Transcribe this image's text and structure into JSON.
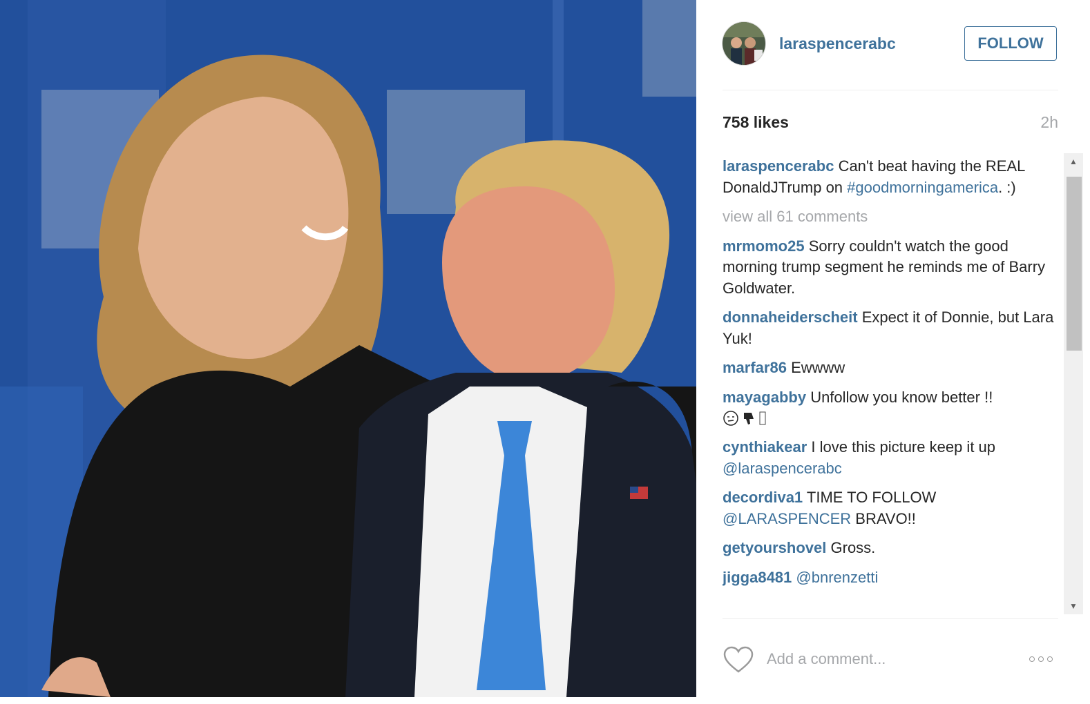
{
  "post": {
    "username": "laraspencerabc",
    "follow_label": "FOLLOW",
    "likes": "758 likes",
    "time": "2h",
    "caption": {
      "username": "laraspencerabc",
      "text": "Can't beat having the REAL DonaldJTrump on",
      "hashtag": "#goodmorningamerica",
      "tail": ". :)"
    },
    "view_all": "view all 61 comments",
    "comments": [
      {
        "username": "mrmomo25",
        "text": "Sorry couldn't watch the good morning trump segment he reminds me of Barry Goldwater."
      },
      {
        "username": "donnaheiderscheit",
        "text": "Expect it of Donnie, but Lara Yuk!"
      },
      {
        "username": "marfar86",
        "text": "Ewwww"
      },
      {
        "username": "mayagabby",
        "text": "Unfollow you know better !!"
      },
      {
        "username": "cynthiakear",
        "text": "I love this picture keep it up",
        "mention": "@laraspencerabc"
      },
      {
        "username": "decordiva1",
        "text": "TIME TO FOLLOW",
        "mention": "@LARASPENCER",
        "tail": "BRAVO!!"
      },
      {
        "username": "getyourshovel",
        "text": "Gross."
      },
      {
        "username": "jigga8481",
        "mention": "@bnrenzetti"
      }
    ],
    "comment_placeholder": "Add a comment...",
    "icons": {
      "heart": "heart-outline-icon",
      "more": "more-options-icon",
      "emoji1": "unamused-face-icon",
      "emoji2": "thumbs-down-icon",
      "emoji3": "missing-glyph-icon"
    },
    "colors": {
      "link": "#3f729b",
      "text": "#262626",
      "muted": "#a5a7aa",
      "backdrop": "#24539f"
    }
  }
}
